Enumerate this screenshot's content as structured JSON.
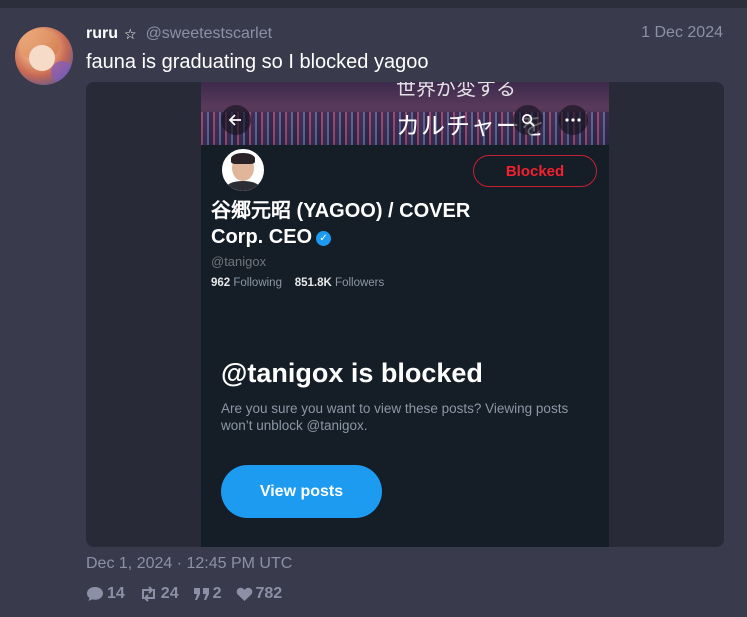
{
  "post": {
    "display_name": "ruru",
    "handle": "@sweetestscarlet",
    "date": "1 Dec 2024",
    "text": "fauna is graduating so I blocked yagoo",
    "timestamp": "Dec 1, 2024 · 12:45 PM UTC",
    "stats": {
      "replies": "14",
      "reposts": "24",
      "quotes": "2",
      "likes": "782"
    }
  },
  "screenshot": {
    "banner_text_top": "世界が変する",
    "banner_text": "カルチャーを",
    "blocked_label": "Blocked",
    "profile_name": "谷郷元昭 (YAGOO) / COVER Corp. CEO",
    "profile_handle": "@tanigox",
    "following_count": "962",
    "following_label": "Following",
    "followers_count": "851.8K",
    "followers_label": "Followers",
    "blocked_title": "@tanigox is blocked",
    "blocked_desc": "Are you sure you want to view these posts? Viewing posts won’t unblock @tanigox.",
    "view_posts_label": "View posts"
  },
  "colors": {
    "background": "#393b4d",
    "accent": "#1d9bf0",
    "blocked_red": "#f4212e"
  }
}
